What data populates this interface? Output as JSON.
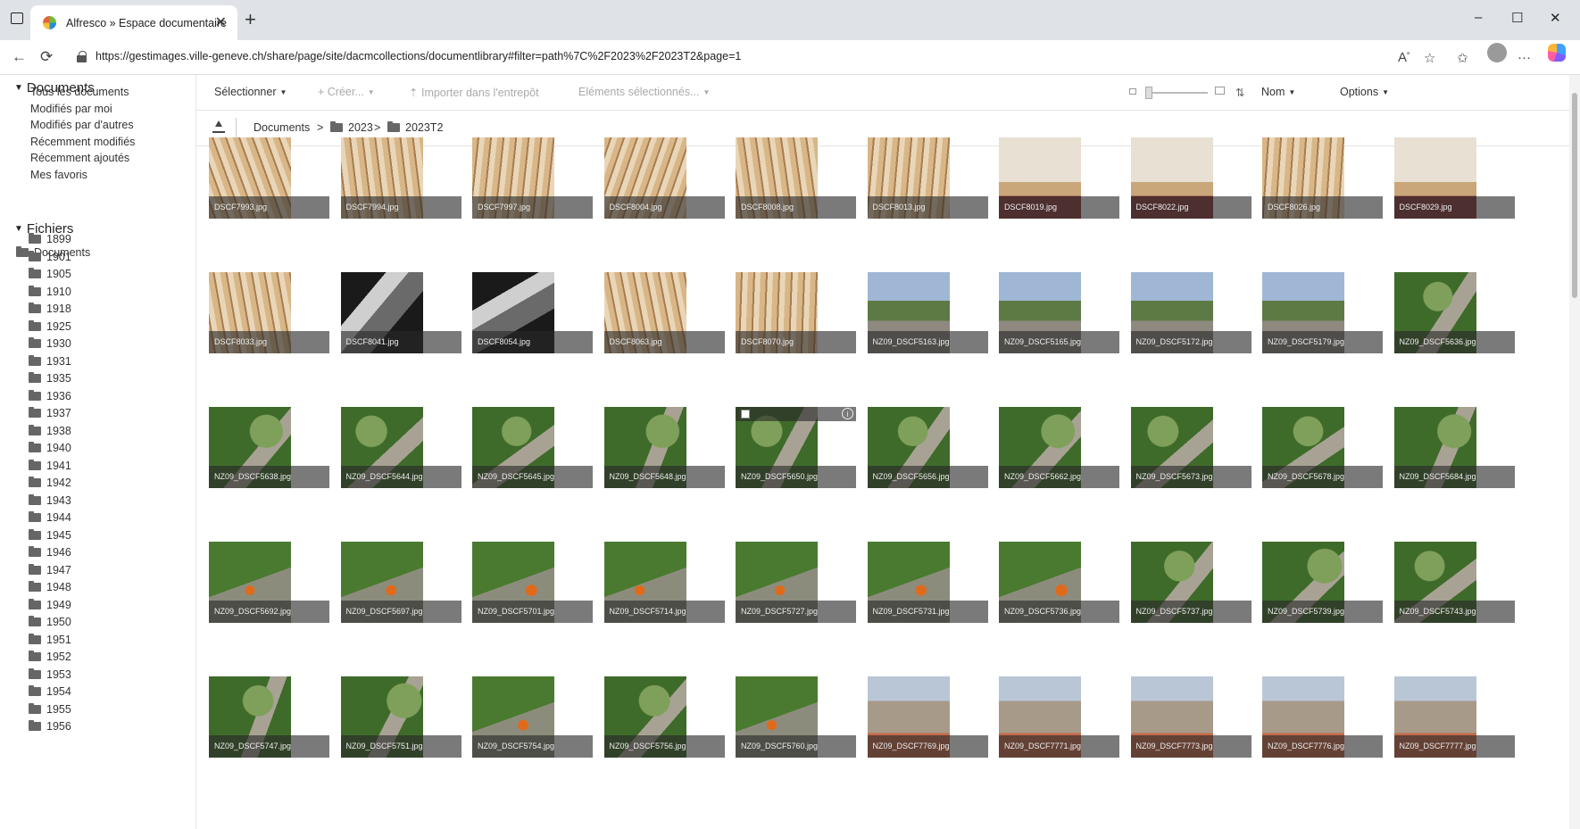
{
  "browser": {
    "tab_title": "Alfresco » Espace documentaire",
    "url": "https://gestimages.ville-geneve.ch/share/page/site/dacmcollections/documentlibrary#filter=path%7C%2F2023%2F2023T2&page=1",
    "controls": {
      "minimize": "–",
      "maximize": "☐",
      "close": "✕",
      "tab_close": "✕",
      "new_tab": "+",
      "back": "←",
      "reload": "⟳",
      "more": "···"
    }
  },
  "sidebar": {
    "documents_header": "Documents",
    "links": [
      "Tous les documents",
      "Modifiés par moi",
      "Modifiés par d'autres",
      "Récemment modifiés",
      "Récemment ajoutés",
      "Mes favoris"
    ],
    "files_header": "Fichiers",
    "root_folder": "Documents",
    "folders": [
      "1899",
      "1901",
      "1905",
      "1910",
      "1918",
      "1925",
      "1930",
      "1931",
      "1935",
      "1936",
      "1937",
      "1938",
      "1940",
      "1941",
      "1942",
      "1943",
      "1944",
      "1945",
      "1946",
      "1947",
      "1948",
      "1949",
      "1950",
      "1951",
      "1952",
      "1953",
      "1954",
      "1955",
      "1956"
    ]
  },
  "toolbar": {
    "select": "Sélectionner",
    "create": "Créer...",
    "import": "Importer dans l'entrepôt",
    "selected_items": "Eléments sélectionnés...",
    "sort": "Nom",
    "options": "Options"
  },
  "breadcrumb": {
    "root": "Documents",
    "level1": "2023",
    "level2": "2023T2",
    "separator": ">"
  },
  "files": [
    "DSCF7993.jpg",
    "DSCF7994.jpg",
    "DSCF7997.jpg",
    "DSCF8004.jpg",
    "DSCF8008.jpg",
    "DSCF8013.jpg",
    "DSCF8019.jpg",
    "DSCF8022.jpg",
    "DSCF8026.jpg",
    "DSCF8029.jpg",
    "DSCF8033.jpg",
    "DSCF8041.jpg",
    "DSCF8054.jpg",
    "DSCF8063.jpg",
    "DSCF8070.jpg",
    "NZ09_DSCF5163.jpg",
    "NZ09_DSCF5165.jpg",
    "NZ09_DSCF5172.jpg",
    "NZ09_DSCF5179.jpg",
    "NZ09_DSCF5636.jpg",
    "NZ09_DSCF5638.jpg",
    "NZ09_DSCF5644.jpg",
    "NZ09_DSCF5645.jpg",
    "NZ09_DSCF5648.jpg",
    "NZ09_DSCF5650.jpg",
    "NZ09_DSCF5656.jpg",
    "NZ09_DSCF5662.jpg",
    "NZ09_DSCF5673.jpg",
    "NZ09_DSCF5678.jpg",
    "NZ09_DSCF5684.jpg",
    "NZ09_DSCF5692.jpg",
    "NZ09_DSCF5697.jpg",
    "NZ09_DSCF5701.jpg",
    "NZ09_DSCF5714.jpg",
    "NZ09_DSCF5727.jpg",
    "NZ09_DSCF5731.jpg",
    "NZ09_DSCF5736.jpg",
    "NZ09_DSCF5737.jpg",
    "NZ09_DSCF5739.jpg",
    "NZ09_DSCF5743.jpg",
    "NZ09_DSCF5747.jpg",
    "NZ09_DSCF5751.jpg",
    "NZ09_DSCF5754.jpg",
    "NZ09_DSCF5756.jpg",
    "NZ09_DSCF5760.jpg",
    "NZ09_DSCF7769.jpg",
    "NZ09_DSCF7771.jpg",
    "NZ09_DSCF7773.jpg",
    "NZ09_DSCF7776.jpg",
    "NZ09_DSCF7777.jpg"
  ],
  "hovered_file_index": 24,
  "thumb_palettes": {
    "wood": [
      "#d8b687",
      "#a87d4f",
      "#e9d6b9"
    ],
    "interior": [
      "#e8e0d2",
      "#8a3b3b",
      "#c9a77a"
    ],
    "dark": [
      "#1a1a1a",
      "#6a6a6a",
      "#cfcfcf"
    ],
    "street": [
      "#9fb7d4",
      "#8e8a80",
      "#5d7a44"
    ],
    "forest": [
      "#3f6b2a",
      "#7fa05a",
      "#a8a294"
    ],
    "work": [
      "#4a7a30",
      "#e06a1a",
      "#8c8c7c"
    ],
    "city": [
      "#b9c6d6",
      "#a89a88",
      "#c46a4a"
    ]
  },
  "thumb_types": [
    "wood",
    "wood",
    "wood",
    "wood",
    "wood",
    "wood",
    "interior",
    "interior",
    "wood",
    "interior",
    "wood",
    "dark",
    "dark",
    "wood",
    "wood",
    "street",
    "street",
    "street",
    "street",
    "forest",
    "forest",
    "forest",
    "forest",
    "forest",
    "forest",
    "forest",
    "forest",
    "forest",
    "forest",
    "forest",
    "work",
    "work",
    "work",
    "work",
    "work",
    "work",
    "work",
    "forest",
    "forest",
    "forest",
    "forest",
    "forest",
    "work",
    "forest",
    "work",
    "city",
    "city",
    "city",
    "city",
    "city"
  ]
}
